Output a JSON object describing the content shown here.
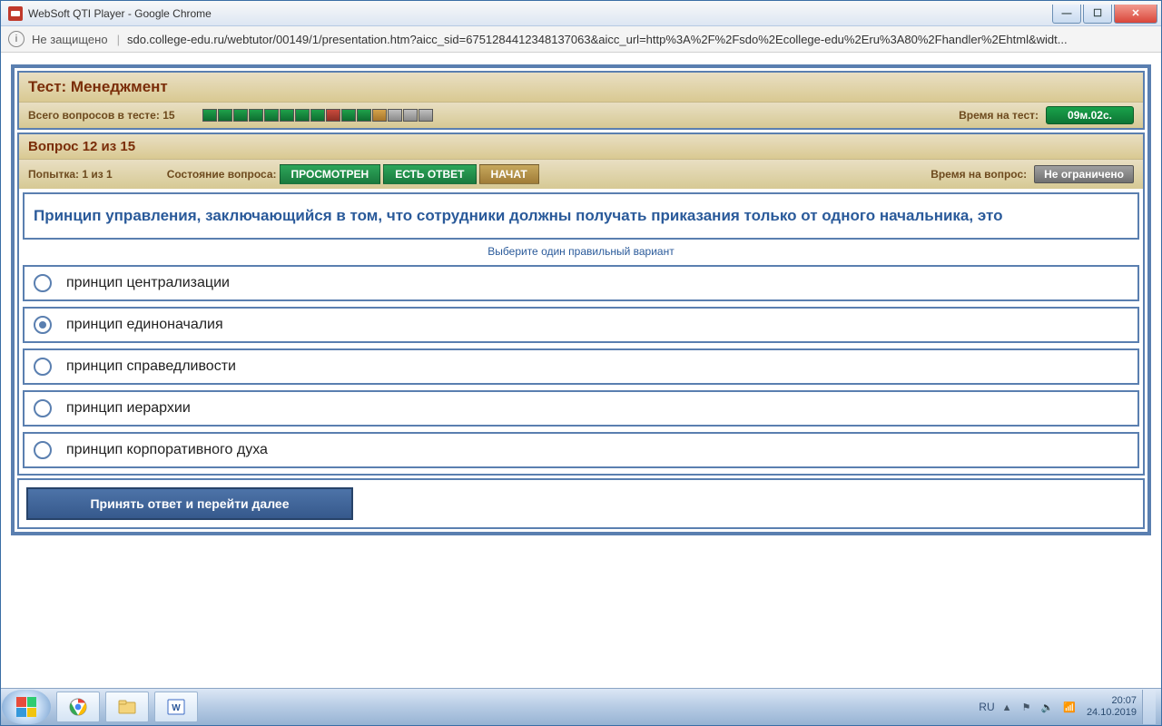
{
  "window": {
    "title": "WebSoft QTI Player - Google Chrome",
    "security_label": "Не защищено",
    "url": "sdo.college-edu.ru/webtutor/00149/1/presentation.htm?aicc_sid=6751284412348137063&aicc_url=http%3A%2F%2Fsdo%2Ecollege-edu%2Eru%3A80%2Fhandler%2Ehtml&widt..."
  },
  "test": {
    "title": "Тест: Менеджмент",
    "total_label": "Всего вопросов в тесте: 15",
    "progress": [
      "green",
      "green",
      "green",
      "green",
      "green",
      "green",
      "green",
      "green",
      "red",
      "green",
      "green",
      "orange",
      "gray",
      "gray",
      "gray"
    ],
    "time_test_label": "Время на тест:",
    "time_test_value": "09м.02с.",
    "question_header": "Вопрос 12 из 15",
    "attempt_label": "Попытка: 1 из 1",
    "state_label": "Состояние вопроса:",
    "state_viewed": "ПРОСМОТРЕН",
    "state_answered": "ЕСТЬ ОТВЕТ",
    "state_started": "НАЧАТ",
    "time_q_label": "Время на вопрос:",
    "time_q_value": "Не ограничено",
    "question_text": "Принцип управления, заключающийся в том, что сотрудники должны получать приказания только от одного начальника, это",
    "hint": "Выберите один правильный вариант",
    "options": [
      "принцип централизации",
      "принцип единоначалия",
      "принцип справедливости",
      "принцип иерархии",
      "принцип корпоративного духа"
    ],
    "selected_index": 1,
    "submit_label": "Принять ответ и перейти далее"
  },
  "taskbar": {
    "lang": "RU",
    "clock_time": "20:07",
    "clock_date": "24.10.2019"
  }
}
